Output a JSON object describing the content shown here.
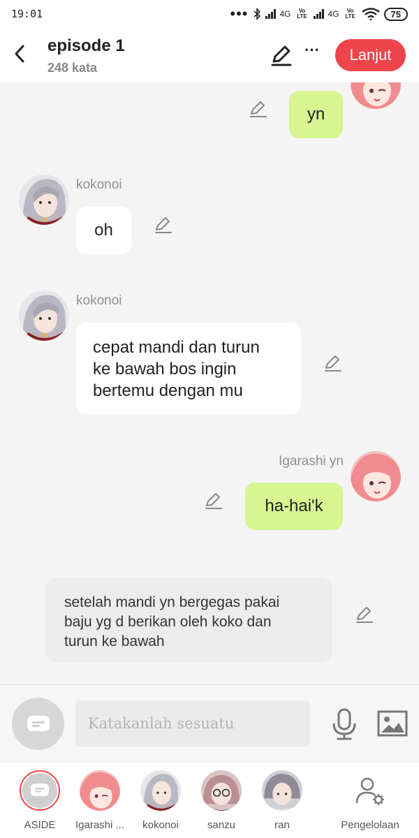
{
  "status_bar": {
    "time": "19:01",
    "net1": "4G",
    "volte1": "Vo LTE",
    "net2": "4G",
    "volte2": "Vo LTE",
    "battery": "75"
  },
  "header": {
    "title": "episode 1",
    "word_count": "248 kata",
    "next_label": "Lanjut",
    "more_label": "···"
  },
  "messages": [
    {
      "speaker": "",
      "text": "yn",
      "side": "right"
    },
    {
      "speaker": "kokonoi",
      "text": "oh",
      "side": "left"
    },
    {
      "speaker": "kokonoi",
      "lines": [
        "cepat mandi dan turun",
        "ke bawah bos ingin",
        "bertemu dengan mu"
      ],
      "side": "left"
    },
    {
      "speaker": "Igarashi yn",
      "text": "ha-hai'k",
      "side": "right"
    },
    {
      "speaker": "",
      "lines": [
        "setelah mandi yn bergegas pakai",
        "baju yg d berikan oleh koko dan",
        "turun ke bawah"
      ],
      "side": "narration"
    }
  ],
  "input": {
    "placeholder": "Katakanlah sesuatu"
  },
  "characters": [
    {
      "label": "ASIDE"
    },
    {
      "label": "Igarashi ..."
    },
    {
      "label": "kokonoi"
    },
    {
      "label": "sanzu"
    },
    {
      "label": "ran"
    },
    {
      "label": "Pengelolaan"
    }
  ],
  "colors": {
    "accent": "#f0444b",
    "bubble_green": "#d7f591",
    "bubble_white": "#ffffff",
    "narration_bg": "#ececec"
  }
}
